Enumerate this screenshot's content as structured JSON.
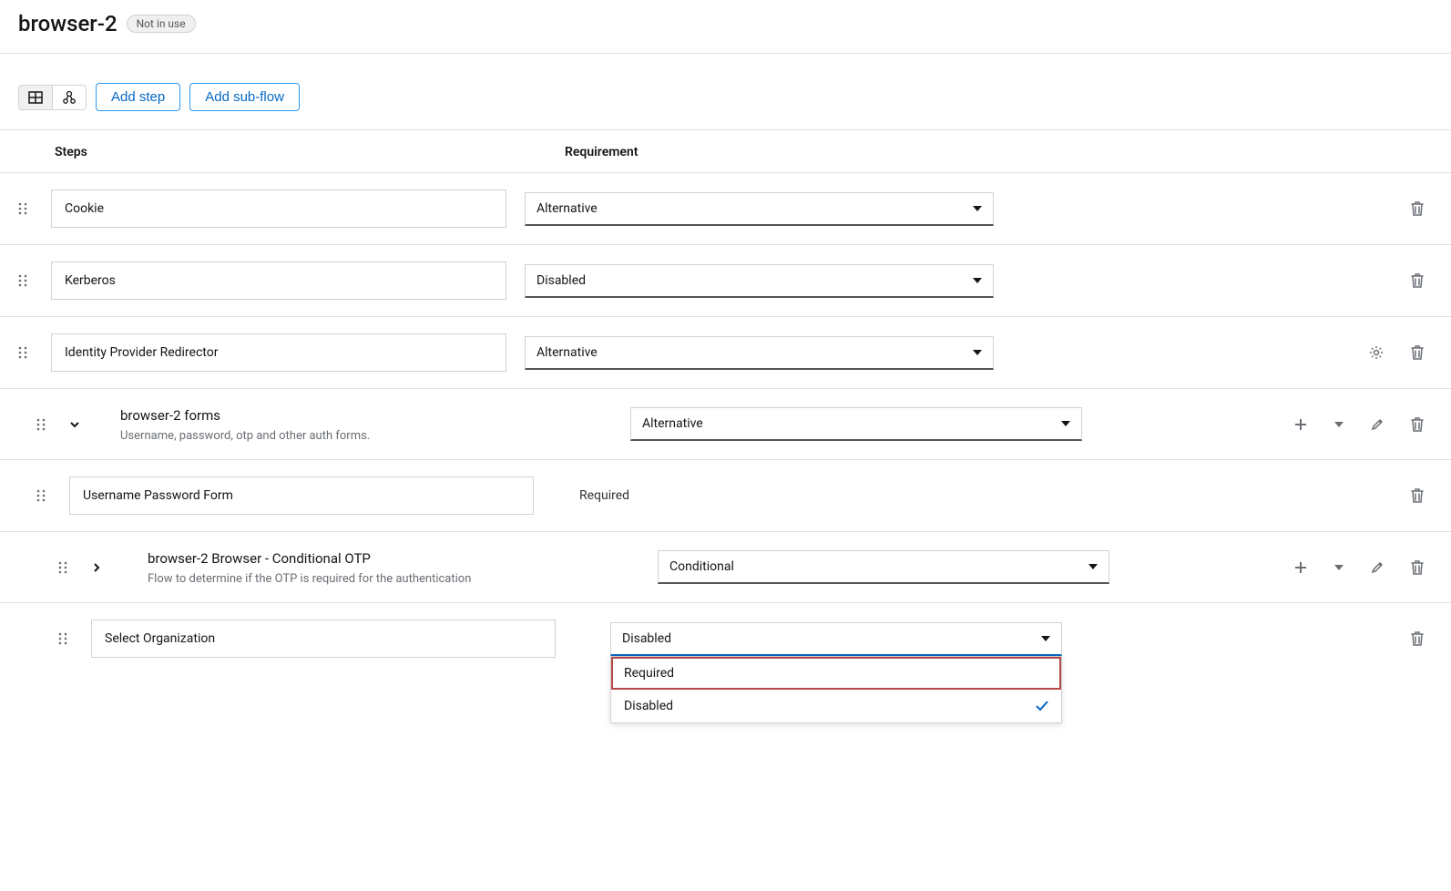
{
  "header": {
    "title": "browser-2",
    "badge": "Not in use"
  },
  "toolbar": {
    "add_step": "Add step",
    "add_subflow": "Add sub-flow"
  },
  "columns": {
    "steps": "Steps",
    "requirement": "Requirement"
  },
  "rows": [
    {
      "name": "Cookie",
      "requirement": "Alternative",
      "boxed": true,
      "trash": true
    },
    {
      "name": "Kerberos",
      "requirement": "Disabled",
      "boxed": true,
      "trash": true
    },
    {
      "name": "Identity Provider Redirector",
      "requirement": "Alternative",
      "boxed": true,
      "gear": true,
      "trash": true
    },
    {
      "name": "browser-2 forms",
      "desc": "Username, password, otp and other auth forms.",
      "requirement": "Alternative",
      "expandable": "down",
      "plus": true,
      "chevron": true,
      "edit": true,
      "trash": true,
      "indent": 1,
      "wideSelect": true
    },
    {
      "name": "Username Password Form",
      "requirement": "Required",
      "boxed": true,
      "staticReq": true,
      "trash": true,
      "indent": 2
    },
    {
      "name": "browser-2 Browser - Conditional OTP",
      "desc": "Flow to determine if the OTP is required for the authentication",
      "requirement": "Conditional",
      "expandable": "right",
      "plus": true,
      "chevron": true,
      "edit": true,
      "trash": true,
      "indent": 2,
      "padDrag": true,
      "wideSelect": true
    },
    {
      "name": "Select Organization",
      "requirement": "Disabled",
      "boxed": true,
      "trash": true,
      "indent": 2,
      "padDrag": true,
      "dropdown_open": true
    }
  ],
  "dropdown": {
    "options": [
      "Required",
      "Disabled"
    ],
    "selected": "Disabled"
  }
}
